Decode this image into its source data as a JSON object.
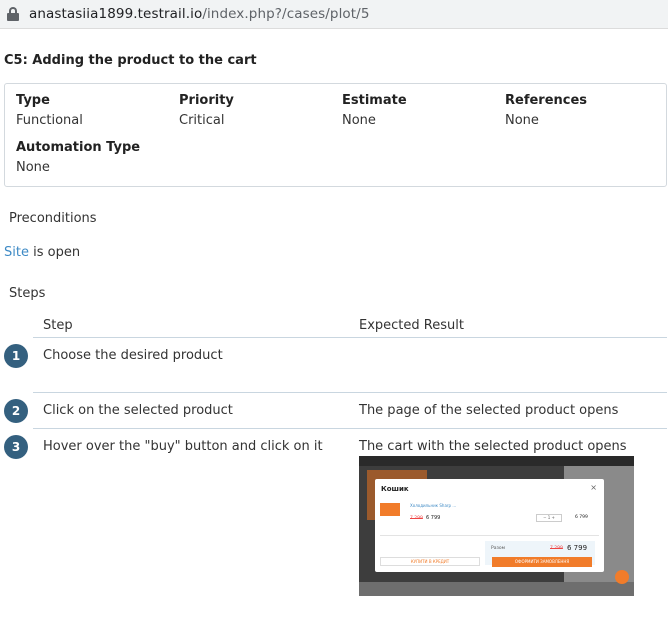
{
  "browser": {
    "url_host": "anastasiia1899.testrail.io",
    "url_path": "/index.php?/cases/plot/5"
  },
  "case": {
    "title": "C5: Adding the product to the cart"
  },
  "properties": {
    "type": {
      "label": "Type",
      "value": "Functional"
    },
    "priority": {
      "label": "Priority",
      "value": "Critical"
    },
    "estimate": {
      "label": "Estimate",
      "value": "None"
    },
    "references": {
      "label": "References",
      "value": "None"
    },
    "automation_type": {
      "label": "Automation Type",
      "value": "None"
    }
  },
  "preconditions": {
    "heading": "Preconditions",
    "link_text": "Site",
    "rest_text": " is open"
  },
  "steps": {
    "heading": "Steps",
    "col_step": "Step",
    "col_expected": "Expected Result",
    "items": [
      {
        "num": "1",
        "step": "Choose the desired product",
        "expected": ""
      },
      {
        "num": "2",
        "step": "Click on the selected product",
        "expected": "The page of the selected product opens"
      },
      {
        "num": "3",
        "step": "Hover over the \"buy\" button and click on it",
        "expected": "The cart with the selected product opens"
      }
    ]
  },
  "attachment": {
    "modal_title": "Кошик",
    "close": "×",
    "product_name": "Холодильник Sharp ...",
    "old_price": "7 299",
    "new_price": "6 799",
    "qty": "− 1 +",
    "line_price": "6 799",
    "total_label": "Разом",
    "total_old": "7 299",
    "total_new": "6 799",
    "credit_btn": "КУПИТИ В КРЕДИТ",
    "checkout_btn": "ОФОРМИТИ ЗАМОВЛЕННЯ"
  },
  "colors": {
    "link": "#3e8ac5",
    "step_badge": "#34607f",
    "accent_orange": "#f17c2a"
  }
}
